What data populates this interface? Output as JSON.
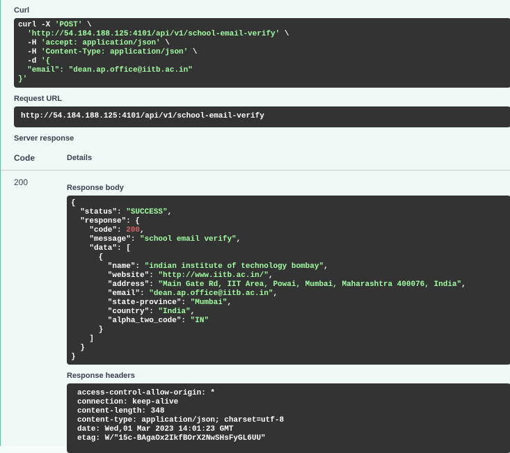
{
  "curl": {
    "label": "Curl",
    "lines": [
      [
        "curl -X ",
        "'POST'",
        " \\"
      ],
      [
        "  ",
        "'http://54.184.188.125:4101/api/v1/school-email-verify'",
        " \\"
      ],
      [
        "  -H ",
        "'accept: application/json'",
        " \\"
      ],
      [
        "  -H ",
        "'Content-Type: application/json'",
        " \\"
      ],
      [
        "  -d ",
        "'{",
        ""
      ],
      [
        "  ",
        "\"email\": \"dean.ap.office@iitb.ac.in\"",
        ""
      ],
      [
        "",
        "}'",
        ""
      ]
    ]
  },
  "request_url": {
    "label": "Request URL",
    "value": "http://54.184.188.125:4101/api/v1/school-email-verify"
  },
  "server_response": {
    "label": "Server response",
    "code_header": "Code",
    "details_header": "Details",
    "code": "200",
    "body_label": "Response body",
    "headers_label": "Response headers",
    "body_lines": [
      [
        [
          "punc",
          "{"
        ]
      ],
      [
        [
          "punc",
          "  \"status\": "
        ],
        [
          "str",
          "\"SUCCESS\""
        ],
        [
          "punc",
          ","
        ]
      ],
      [
        [
          "punc",
          "  \"response\": {"
        ]
      ],
      [
        [
          "punc",
          "    \"code\": "
        ],
        [
          "num",
          "200"
        ],
        [
          "punc",
          ","
        ]
      ],
      [
        [
          "punc",
          "    \"message\": "
        ],
        [
          "str",
          "\"school email verify\""
        ],
        [
          "punc",
          ","
        ]
      ],
      [
        [
          "punc",
          "    \"data\": ["
        ]
      ],
      [
        [
          "punc",
          "      {"
        ]
      ],
      [
        [
          "punc",
          "        \"name\": "
        ],
        [
          "str",
          "\"indian institute of technology bombay\""
        ],
        [
          "punc",
          ","
        ]
      ],
      [
        [
          "punc",
          "        \"website\": "
        ],
        [
          "str",
          "\"http://www.iitb.ac.in/\""
        ],
        [
          "punc",
          ","
        ]
      ],
      [
        [
          "punc",
          "        \"address\": "
        ],
        [
          "str",
          "\"Main Gate Rd, IIT Area, Powai, Mumbai, Maharashtra 400076, India\""
        ],
        [
          "punc",
          ","
        ]
      ],
      [
        [
          "punc",
          "        \"email\": "
        ],
        [
          "str",
          "\"dean.ap.office@iitb.ac.in\""
        ],
        [
          "punc",
          ","
        ]
      ],
      [
        [
          "punc",
          "        \"state-province\": "
        ],
        [
          "str",
          "\"Mumbai\""
        ],
        [
          "punc",
          ","
        ]
      ],
      [
        [
          "punc",
          "        \"country\": "
        ],
        [
          "str",
          "\"India\""
        ],
        [
          "punc",
          ","
        ]
      ],
      [
        [
          "punc",
          "        \"alpha_two_code\": "
        ],
        [
          "str",
          "\"IN\""
        ]
      ],
      [
        [
          "punc",
          "      }"
        ]
      ],
      [
        [
          "punc",
          "    ]"
        ]
      ],
      [
        [
          "punc",
          "  }"
        ]
      ],
      [
        [
          "punc",
          "}"
        ]
      ]
    ],
    "header_lines": [
      "access-control-allow-origin: *",
      "connection: keep-alive",
      "content-length: 348",
      "content-type: application/json; charset=utf-8",
      "date: Wed,01 Mar 2023 14:01:23 GMT",
      "etag: W/\"15c-BAgaOx2IkfBOrX2NwSHsFyGL6UU\""
    ]
  }
}
